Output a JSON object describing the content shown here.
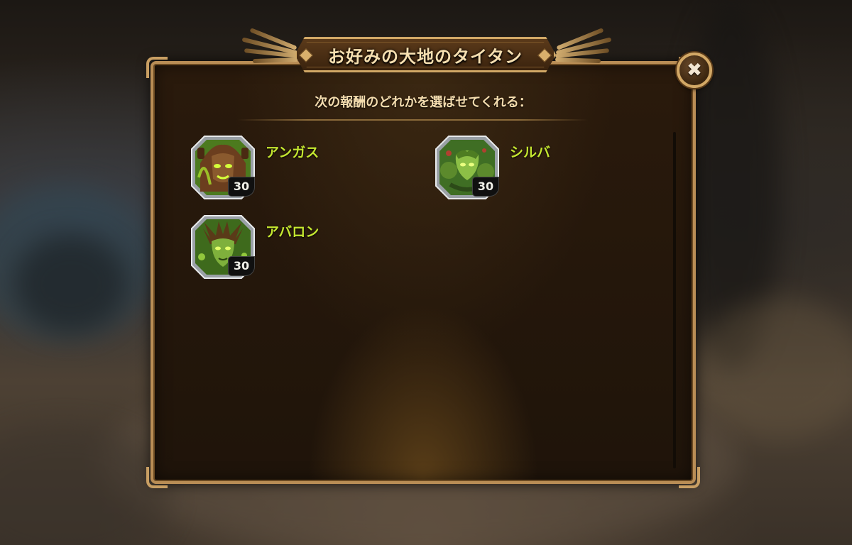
{
  "dialog": {
    "title": "お好みの大地のタイタン",
    "subtitle": "次の報酬のどれかを選ばせてくれる：",
    "close_icon": "close-x-icon"
  },
  "rewards": [
    {
      "name": "アンガス",
      "level": "30",
      "portrait": "angus-titan-portrait",
      "accent": "#5b3a22"
    },
    {
      "name": "シルバ",
      "level": "30",
      "portrait": "sylva-titan-portrait",
      "accent": "#2f5a2a"
    },
    {
      "name": "アバロン",
      "level": "30",
      "portrait": "avalon-titan-portrait",
      "accent": "#4a3a1a"
    }
  ],
  "colors": {
    "frame_gold": "#b98d55",
    "hero_name": "#c4e630",
    "title_text": "#f6dfb0"
  }
}
